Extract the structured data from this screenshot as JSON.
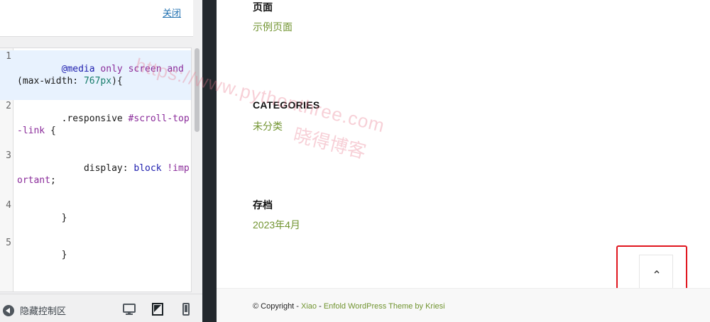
{
  "panel": {
    "close_label": "关闭",
    "collapse_label": "隐藏控制区",
    "collapse_icon": "collapse-left-icon",
    "devices": [
      "desktop-icon",
      "tablet-icon",
      "mobile-icon"
    ]
  },
  "editor": {
    "line_numbers": [
      "1",
      "2",
      "3",
      "4",
      "5"
    ],
    "line1": {
      "kw_media": "@media",
      "kw_only": "only",
      "kw_screen": "screen",
      "kw_and": "and",
      "open": "(max-",
      "prop": "width:",
      "val": "767px",
      "close": "){"
    },
    "line2": {
      "selector": ".responsive",
      "id": "#scroll-top-link",
      "brace": "{"
    },
    "line3": {
      "prop": "display:",
      "val": "block",
      "imp": "!important",
      "semi": ";"
    },
    "line4": "}",
    "line5": "}"
  },
  "preview": {
    "pages_title": "页面",
    "pages_link": "示例页面",
    "categories_title": "CATEGORIES",
    "categories_link": "未分类",
    "archive_title": "存档",
    "archive_link": "2023年4月",
    "scroll_top_icon": "chevron-up-icon",
    "highlight_color": "#e0161f",
    "link_color": "#719430"
  },
  "footer": {
    "copyright": "© Copyright - ",
    "site": "Xiao",
    "sep": " - ",
    "theme": "Enfold WordPress Theme by Kriesi"
  },
  "watermark": {
    "url": "https://www.pythonthree.com",
    "name": "晓得博客"
  }
}
